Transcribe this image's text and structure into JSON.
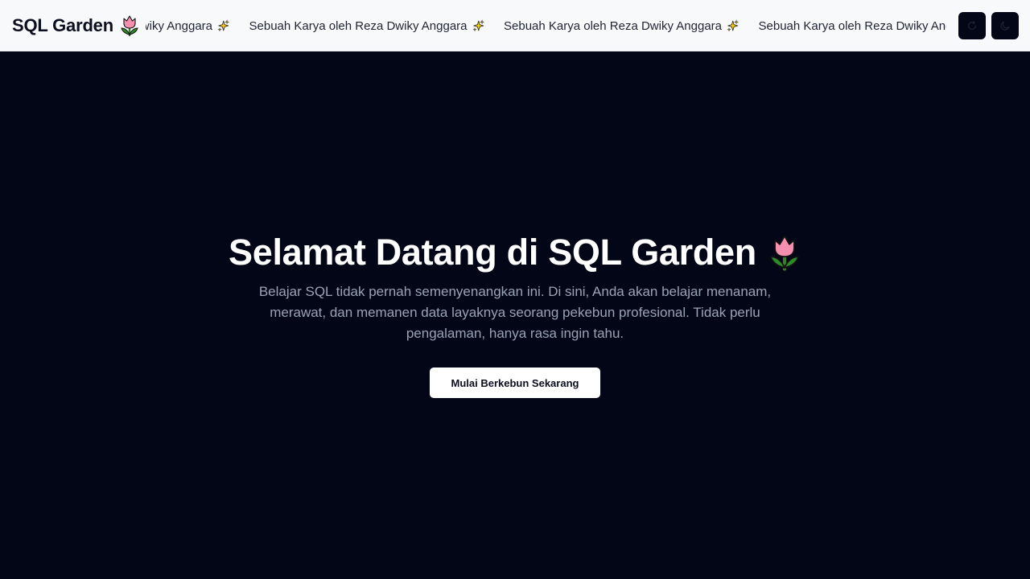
{
  "header": {
    "logo_text": "SQL Garden",
    "logo_icon": "tulip-icon",
    "marquee": {
      "text": "Sebuah Karya oleh Reza Dwiky Anggara",
      "icon": "sparkles-icon",
      "items": [
        "Sebuah Karya oleh Reza Dwiky Anggara",
        "Sebuah Karya oleh Reza Dwiky Anggara",
        "Sebuah Karya oleh Reza Dwiky Anggara",
        "Sebuah Karya oleh Reza Dwiky Anggara"
      ]
    },
    "buttons": [
      {
        "icon": "refresh-icon"
      },
      {
        "icon": "moon-icon"
      }
    ]
  },
  "hero": {
    "title": "Selamat Datang di SQL Garden",
    "title_icon": "tulip-icon",
    "description": "Belajar SQL tidak pernah semenyenangkan ini. Di sini, Anda akan belajar menanam, merawat, dan memanen data layaknya seorang pekebun profesional. Tidak perlu pengalaman, hanya rasa ingin tahu.",
    "cta_label": "Mulai Berkebun Sekarang"
  },
  "colors": {
    "background": "#030616",
    "header_bg": "#f8f9fb",
    "text_primary": "#ffffff",
    "text_muted": "#9aa3b6",
    "button_bg": "#ffffff",
    "icon_button_bg": "#030616"
  }
}
